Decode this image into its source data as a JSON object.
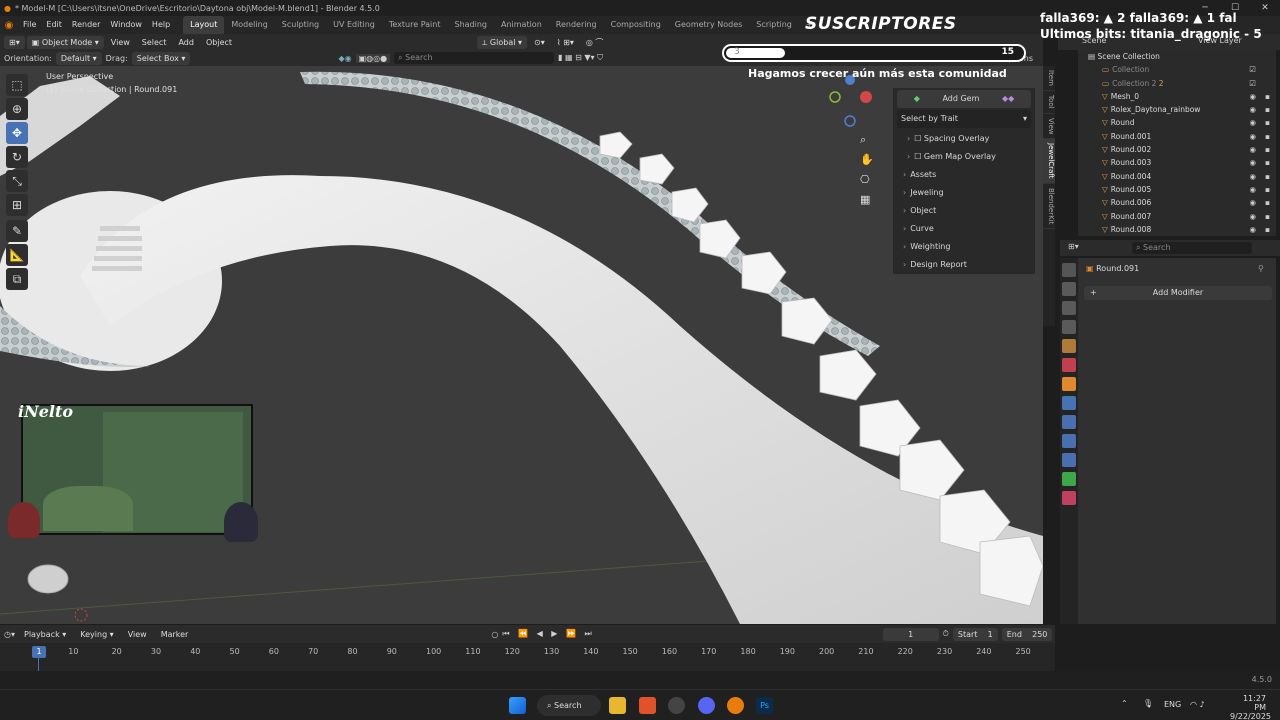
{
  "window": {
    "title": "* Model-M [C:\\Users\\itsne\\OneDrive\\Escritorio\\Daytona obj\\Model-M.blend1] - Blender 4.5.0"
  },
  "menu": [
    "File",
    "Edit",
    "Render",
    "Window",
    "Help"
  ],
  "workspaces": [
    "Layout",
    "Modeling",
    "Sculpting",
    "UV Editing",
    "Texture Paint",
    "Shading",
    "Animation",
    "Rendering",
    "Compositing",
    "Geometry Nodes",
    "Scripting"
  ],
  "workspace_add": "+",
  "header": {
    "mode": "Object Mode",
    "view": "View",
    "select": "Select",
    "add": "Add",
    "object": "Object",
    "transform": "Global",
    "search_placeholder": "Search"
  },
  "options_row": {
    "orientation_label": "Orientation:",
    "orientation_value": "Default",
    "drag_label": "Drag:",
    "drag_value": "Select Box",
    "options": "Options"
  },
  "viewport": {
    "perspective": "User Perspective",
    "collection_info": "(1) Scene Collection | Round.091"
  },
  "npanel": {
    "add_gem": "Add Gem",
    "select_by_trait": "Select by Trait",
    "spacing_overlay": "Spacing Overlay",
    "gem_map_overlay": "Gem Map Overlay",
    "sections": [
      "Assets",
      "Jeweling",
      "Object",
      "Curve",
      "Weighting",
      "Design Report"
    ]
  },
  "sidetabs": [
    "Item",
    "Tool",
    "View",
    "JewelCraft",
    "BlenderKit"
  ],
  "outliner": {
    "scene": "Scene",
    "view_layer": "View Layer",
    "search_placeholder": "Search",
    "root": "Scene Collection",
    "items": [
      {
        "name": "Collection",
        "dim": true
      },
      {
        "name": "Collection 2",
        "dim": true,
        "extra": "2"
      },
      {
        "name": "Mesh_0"
      },
      {
        "name": "Rolex_Daytona_rainbow"
      },
      {
        "name": "Round"
      },
      {
        "name": "Round.001"
      },
      {
        "name": "Round.002"
      },
      {
        "name": "Round.003"
      },
      {
        "name": "Round.004"
      },
      {
        "name": "Round.005"
      },
      {
        "name": "Round.006"
      },
      {
        "name": "Round.007"
      },
      {
        "name": "Round.008"
      }
    ]
  },
  "properties": {
    "search_placeholder": "Search",
    "object_name": "Round.091",
    "add_modifier": "Add Modifier"
  },
  "timeline": {
    "playback": "Playback",
    "keying": "Keying",
    "view": "View",
    "marker": "Marker",
    "current_frame": "1",
    "start_label": "Start",
    "start": "1",
    "end_label": "End",
    "end": "250",
    "ticks": [
      "10",
      "20",
      "30",
      "40",
      "50",
      "60",
      "70",
      "80",
      "90",
      "100",
      "110",
      "120",
      "130",
      "140",
      "150",
      "160",
      "170",
      "180",
      "190",
      "200",
      "210",
      "220",
      "230",
      "240",
      "250"
    ],
    "playhead": "1"
  },
  "status": {
    "version": "4.5.0"
  },
  "taskbar": {
    "search": "Search",
    "lang": "ENG",
    "time": "11:27 PM",
    "date": "9/22/2025"
  },
  "stream": {
    "subs_title": "SUSCRIPTORES",
    "goal_current": "3",
    "goal_target": "15",
    "goal_fraction": 0.2,
    "community": "Hagamos crecer aún más esta comunidad",
    "donors_line1": "falla369: ▲ 2   falla369: ▲ 1   fal",
    "donors_line2": "Ultimos bits: titania_dragonic - 5",
    "cam_name": "iNelto"
  }
}
